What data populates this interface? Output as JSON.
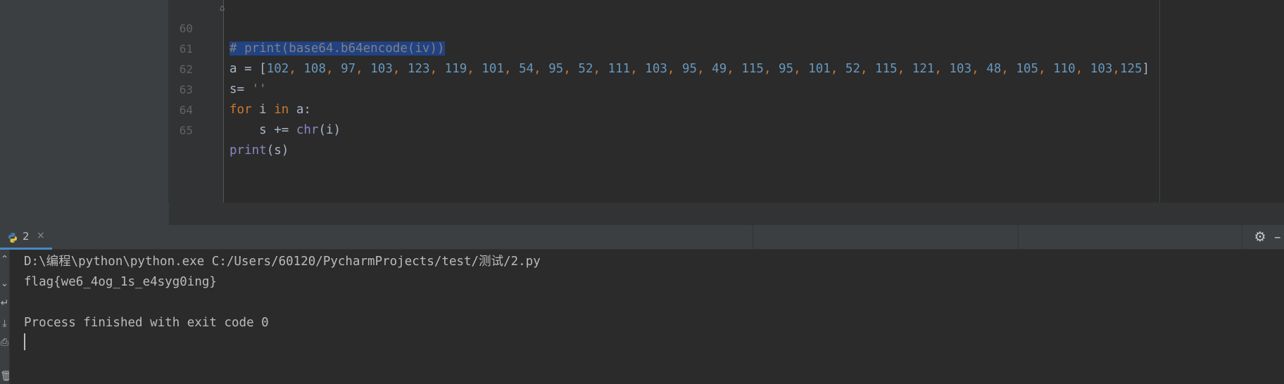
{
  "editor": {
    "lines": [
      {
        "number": "60",
        "text": "# print(base64.b64encode(iv))"
      },
      {
        "number": "61",
        "text": "a = [102, 108, 97, 103, 123, 119, 101, 54, 95, 52, 111, 103, 95, 49, 115, 95, 101, 52, 115, 121, 103, 48, 105, 110, 103,125]"
      },
      {
        "number": "62",
        "text": "s= ''"
      },
      {
        "number": "63",
        "text": "for i in a:"
      },
      {
        "number": "64",
        "text": "    s += chr(i)"
      },
      {
        "number": "65",
        "text": "print(s)"
      }
    ]
  },
  "run_panel": {
    "tab_label": "2",
    "tab_close": "×",
    "gear_icon": "gear-icon",
    "minimize_icon": "minimize-icon",
    "output": {
      "command": "D:\\编程\\python\\python.exe C:/Users/60120/PycharmProjects/test/测试/2.py",
      "result": "flag{we6_4og_1s_e4syg0ing}",
      "exit_message": "Process finished with exit code 0"
    }
  },
  "colors": {
    "background": "#2b2b2b",
    "selection": "#214283",
    "number": "#6897bb",
    "keyword": "#cc7832",
    "string": "#6a8759",
    "builtin": "#8888c6",
    "comment": "#808080",
    "tab_accent": "#4a88c7"
  }
}
